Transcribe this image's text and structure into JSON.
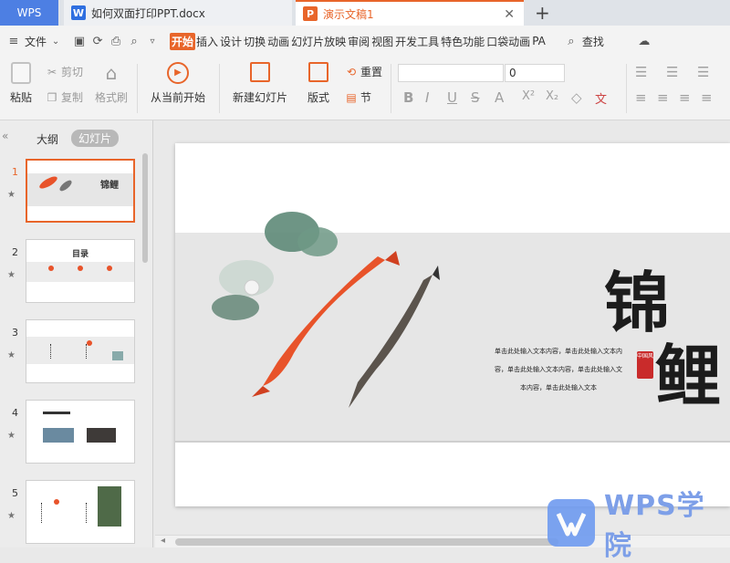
{
  "tabs": {
    "wps": "WPS",
    "doc": "如何双面打印PPT.docx",
    "ppt": "演示文稿1",
    "doc_icon": "W",
    "ppt_icon": "P"
  },
  "menubar": {
    "file": "文件",
    "items": [
      "开始",
      "插入",
      "设计",
      "切换",
      "动画",
      "幻灯片放映",
      "审阅",
      "视图",
      "开发工具",
      "特色功能",
      "口袋动画",
      "PA"
    ],
    "search": "查找"
  },
  "ribbon": {
    "paste": "粘贴",
    "cut": "剪切",
    "copy": "复制",
    "format_painter": "格式刷",
    "play_from_current": "从当前开始",
    "new_slide": "新建幻灯片",
    "layout": "版式",
    "reset": "重置",
    "section": "节",
    "font_size": "0"
  },
  "left_panel": {
    "outline_tab": "大纲",
    "slides_tab": "幻灯片",
    "thumbnails": [
      {
        "num": "1",
        "caption": "锦鲤"
      },
      {
        "num": "2",
        "caption": "目录"
      },
      {
        "num": "3",
        "caption": ""
      },
      {
        "num": "4",
        "caption": ""
      },
      {
        "num": "5",
        "caption": ""
      }
    ]
  },
  "slide": {
    "title_char1": "锦",
    "title_char2": "鲤",
    "body_lines": [
      "单击此处输入文本内容，单击此处输入文本内",
      "容，单击此处输入文本内容，单击此处输入文",
      "本内容，单击此处输入文本"
    ],
    "seal_text": "中国风"
  },
  "watermark": {
    "text": "WPS学院"
  }
}
